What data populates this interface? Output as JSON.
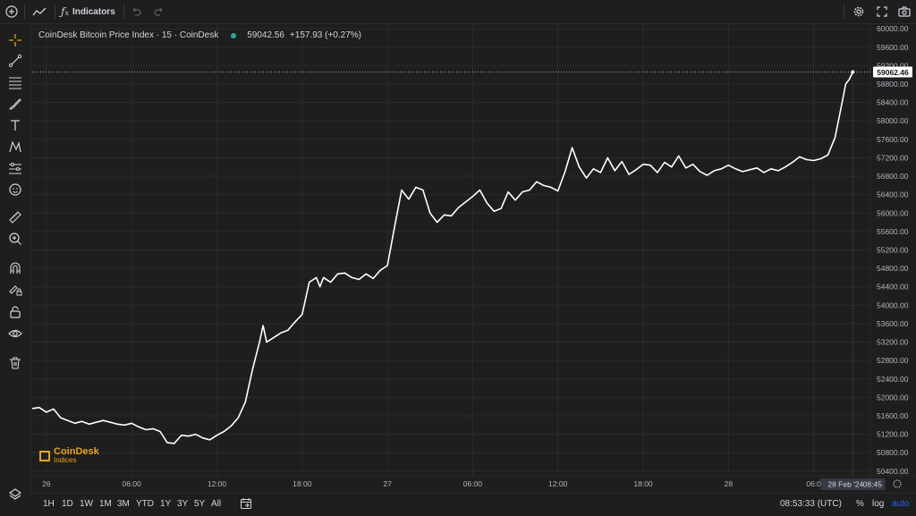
{
  "topbar": {
    "indicators_label": "Indicators"
  },
  "legend": {
    "title": "CoinDesk Bitcoin Price Index · 15 · CoinDesk",
    "price": "59042.56",
    "change": "+157.93 (+0.27%)",
    "change_color": "#d1d4dc",
    "status_color": "#26a69a"
  },
  "branding": {
    "logo_name": "CoinDesk",
    "logo_sub": "Indices",
    "brand_color": "#e8a317"
  },
  "bottombar": {
    "ranges": [
      "1H",
      "1D",
      "1W",
      "1M",
      "3M",
      "YTD",
      "1Y",
      "3Y",
      "5Y",
      "All"
    ],
    "clock": "08:53:33 (UTC)",
    "percent_label": "%",
    "log_label": "log",
    "auto_label": "auto",
    "auto_color": "#2962ff"
  },
  "icons": {
    "top": [
      "plus-circle-icon",
      "line-chart-icon",
      "function-icon",
      "undo-icon",
      "redo-icon",
      "settings-icon",
      "fullscreen-icon",
      "camera-icon"
    ],
    "left": [
      "crosshair-icon",
      "trend-line-icon",
      "fib-lines-icon",
      "brush-icon",
      "text-icon",
      "pattern-icon",
      "measure-lines-icon",
      "emoji-icon",
      "ruler-icon",
      "zoom-icon",
      "magnet-icon",
      "lock-drawing-icon",
      "lock-icon",
      "eye-icon",
      "trash-icon",
      "layers-icon"
    ]
  },
  "chart_data": {
    "type": "line",
    "title": "CoinDesk Bitcoin Price Index · 15 · CoinDesk",
    "line_color": "#ffffff",
    "background": "#1e1e1e",
    "grid": true,
    "ylim": [
      50300,
      60100
    ],
    "y_ticks": [
      50400,
      50800,
      51200,
      51600,
      52000,
      52400,
      52800,
      53200,
      53600,
      54000,
      54400,
      54800,
      55200,
      55600,
      56000,
      56400,
      56800,
      57200,
      57600,
      58000,
      58400,
      58800,
      59200,
      59600,
      60000
    ],
    "y_tick_labels": [
      "50400.00",
      "50800.00",
      "51200.00",
      "51600.00",
      "52000.00",
      "52400.00",
      "52800.00",
      "53200.00",
      "53600.00",
      "54000.00",
      "54400.00",
      "54800.00",
      "55200.00",
      "55600.00",
      "56000.00",
      "56400.00",
      "56800.00",
      "57200.00",
      "57600.00",
      "58000.00",
      "58400.00",
      "58800.00",
      "59200.00",
      "59600.00",
      "60000.00"
    ],
    "x_ticks": [
      {
        "label": "26",
        "t": 0
      },
      {
        "label": "06:00",
        "t": 6
      },
      {
        "label": "12:00",
        "t": 12
      },
      {
        "label": "18:00",
        "t": 18
      },
      {
        "label": "27",
        "t": 24
      },
      {
        "label": "06:00",
        "t": 30
      },
      {
        "label": "12:00",
        "t": 36
      },
      {
        "label": "18:00",
        "t": 42
      },
      {
        "label": "28",
        "t": 48
      },
      {
        "label": "06:0",
        "t": 54
      }
    ],
    "x_range": [
      -1,
      57.8
    ],
    "last_price": 59062.46,
    "last_price_label": "59062.46",
    "cursor_date_label": "28 Feb '24",
    "cursor_time_label": "08:45",
    "cursor_t": 56.75,
    "series": [
      {
        "t": [
          -1,
          -0.5,
          0,
          0.5,
          1,
          1.5,
          2,
          2.5,
          3,
          3.5,
          4,
          4.5,
          5,
          5.5,
          6,
          6.5,
          7,
          7.5,
          8,
          8.5,
          9,
          9.5,
          10,
          10.5,
          11,
          11.5,
          12,
          12.5,
          13,
          13.5,
          14,
          14.5,
          15,
          15.25,
          15.5,
          16,
          16.5,
          17,
          17.5,
          18,
          18.5,
          19,
          19.25,
          19.5,
          20,
          20.5,
          21,
          21.5,
          22,
          22.5,
          23,
          23.5,
          24,
          24.5,
          25,
          25.5,
          26,
          26.5,
          27,
          27.5,
          28,
          28.5,
          29,
          29.5,
          30,
          30.5,
          31,
          31.5,
          32,
          32.5,
          33,
          33.5,
          34,
          34.5,
          35,
          35.5,
          36,
          36.5,
          37,
          37.5,
          38,
          38.5,
          39,
          39.5,
          40,
          40.5,
          41,
          41.5,
          42,
          42.5,
          43,
          43.5,
          44,
          44.5,
          45,
          45.5,
          46,
          46.5,
          47,
          47.5,
          48,
          48.5,
          49,
          49.5,
          50,
          50.5,
          51,
          51.5,
          52,
          52.5,
          53,
          53.5,
          54,
          54.5,
          55,
          55.5,
          56,
          56.25,
          56.5,
          56.75
        ],
        "values": [
          51760,
          51780,
          51680,
          51750,
          51560,
          51500,
          51440,
          51480,
          51420,
          51460,
          51500,
          51460,
          51420,
          51400,
          51440,
          51360,
          51300,
          51320,
          51260,
          51020,
          51000,
          51180,
          51160,
          51200,
          51120,
          51080,
          51180,
          51260,
          51380,
          51560,
          51900,
          52600,
          53200,
          53560,
          53200,
          53300,
          53400,
          53460,
          53640,
          53800,
          54500,
          54600,
          54400,
          54600,
          54500,
          54680,
          54700,
          54600,
          54560,
          54680,
          54580,
          54760,
          54860,
          55700,
          56500,
          56300,
          56560,
          56500,
          56000,
          55800,
          55960,
          55940,
          56120,
          56240,
          56360,
          56500,
          56220,
          56040,
          56100,
          56460,
          56280,
          56460,
          56500,
          56680,
          56600,
          56560,
          56480,
          56900,
          57420,
          57000,
          56760,
          56960,
          56880,
          57200,
          56920,
          57120,
          56840,
          56940,
          57060,
          57040,
          56880,
          57100,
          57000,
          57240,
          56980,
          57060,
          56900,
          56820,
          56920,
          56960,
          57040,
          56960,
          56900,
          56940,
          56980,
          56880,
          56960,
          56920,
          57000,
          57100,
          57220,
          57160,
          57140,
          57180,
          57260,
          57640,
          58400,
          58800,
          58900,
          59062
        ]
      }
    ]
  }
}
